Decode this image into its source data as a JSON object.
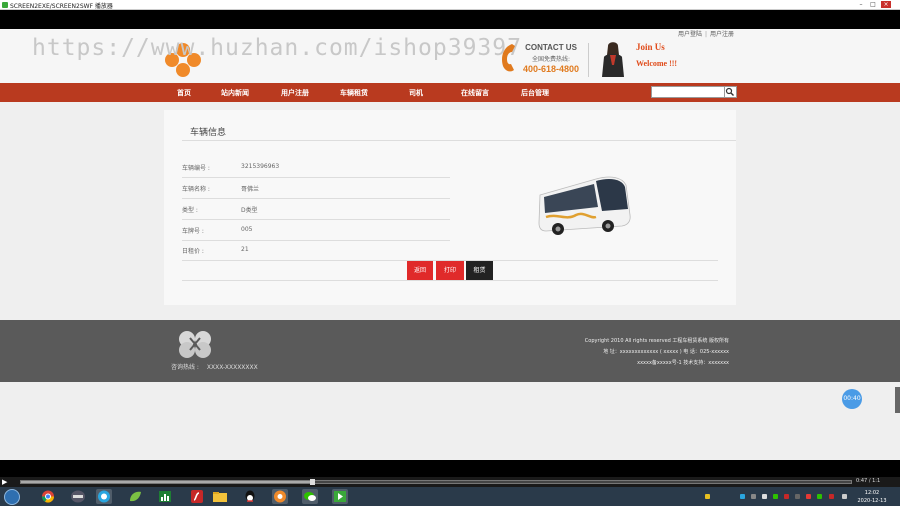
{
  "window": {
    "title": "SCREEN2EXE/SCREEN2SWF 播放器",
    "controls": [
      "–",
      "□",
      "×"
    ]
  },
  "site": {
    "watermark": "https://www.huzhan.com/ishop39397",
    "top_links": [
      "用户登陆",
      "用户注册"
    ],
    "contact": {
      "title": "CONTACT US",
      "subtitle": "全国免费热线:",
      "phone": "400-618-4800"
    },
    "join": {
      "line1": "Join Us",
      "line2": "Welcome !!!"
    },
    "nav": [
      "首页",
      "站内新闻",
      "用户注册",
      "车辆租赁",
      "司机",
      "在线留言",
      "后台管理"
    ],
    "search": {
      "placeholder": "",
      "icon": "search-icon"
    }
  },
  "vehicle": {
    "section_title": "车辆信息",
    "fields": [
      {
        "label": "车辆编号 :",
        "value": "3215396963"
      },
      {
        "label": "车辆名称 :",
        "value": "哥佛兰"
      },
      {
        "label": "类型 :",
        "value": "D类型"
      },
      {
        "label": "车牌号 :",
        "value": "005"
      },
      {
        "label": "日租价 :",
        "value": "21"
      }
    ],
    "buttons": {
      "back": "返回",
      "print": "打印",
      "rent": "租赁"
    }
  },
  "footer": {
    "hotline_label": "咨询热线 :",
    "hotline_value": "XXXX-XXXXXXXX",
    "copyright": "Copyright 2010 All rights reserved 工程车租赁系统 版权所有",
    "address": "地  址：xxxxxxxxxxxxx ( xxxxx )  电  话：025-xxxxxx",
    "support": "xxxxx备xxxxx号-1 技术支持：xxxxxxx"
  },
  "overlay": {
    "timer": "00:40"
  },
  "player": {
    "time": "0:47 / 1:1",
    "progress": 0.35
  },
  "taskbar": {
    "clock_time": "12:02",
    "clock_date": "2020-12-13",
    "apps": [
      "start-orb",
      "chrome",
      "terminal",
      "qq-browser",
      "green-app",
      "chart-app",
      "flash",
      "explorer",
      "qq",
      "orange-app",
      "wechat",
      "screen2exe"
    ]
  },
  "colors": {
    "nav_bar": "#b93a1f",
    "accent_orange": "#e07a1e",
    "button_red": "#e02a2a",
    "button_dark": "#222222",
    "footer_bg": "#5a5a5a",
    "timer_blue": "#4a9be6"
  }
}
